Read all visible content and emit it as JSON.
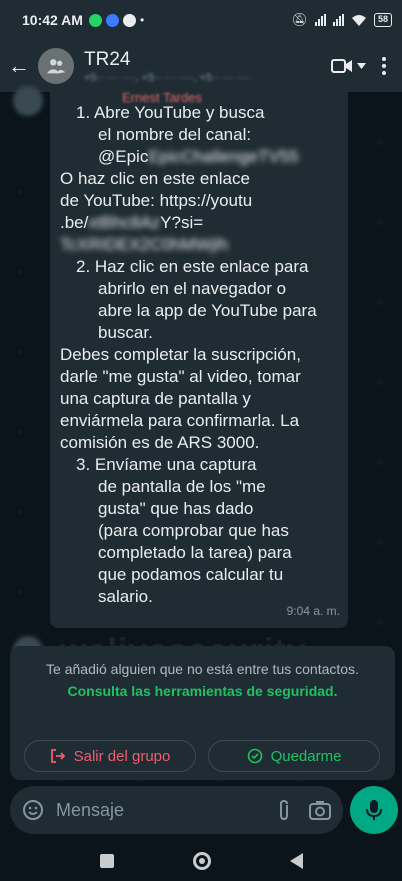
{
  "status_bar": {
    "time": "10:42 AM",
    "battery": "58"
  },
  "header": {
    "back_icon": "arrow-left-icon",
    "chat_title": "TR24",
    "chat_subtitle": "+5·· ··· ····, +5·· ··· ····, +5·· ··· ····",
    "video_icon": "video-call-icon",
    "menu_icon": "more-vert-icon"
  },
  "message": {
    "sender": "Ernest Tardes",
    "lines": {
      "l1": "1. Abre YouTube y busca",
      "l2": "el nombre del canal:",
      "l3": "@Epic",
      "l3_blur": "EpicChallengeTV55",
      "l4": "O haz clic en este enlace",
      "l5": "de YouTube: https://youtu",
      "l6a": ".be/",
      "l6_blur": "xtBhc8Az",
      "l6b": "Y?si=",
      "l7_blur": "TcXRIDEX2C0hMWjlh",
      "l8": "2. Haz clic en este enlace para",
      "l9": "abrirlo en el navegador o",
      "l10": "abre la app de YouTube para",
      "l11": "buscar.",
      "l12": "Debes completar la suscripción,",
      "l13": "darle \"me gusta\" al video, tomar",
      "l14": "una captura de pantalla y",
      "l15": "enviármela para confirmarla. La",
      "l16": "comisión es de ARS 3000.",
      "l17": "3. Envíame una captura",
      "l18": "de pantalla de los \"me",
      "l19": "gusta\" que has dado",
      "l20": "(para comprobar que has",
      "l21": "completado la tarea) para",
      "l22": "que podamos calcular tu",
      "l23": "salario."
    },
    "time": "9:04 a. m."
  },
  "watermark": "welivesecurity",
  "safety": {
    "text": "Te añadió alguien que no está entre tus contactos.",
    "link": "Consulta las herramientas de seguridad.",
    "exit_label": "Salir del grupo",
    "stay_label": "Quedarme"
  },
  "composer": {
    "placeholder": "Mensaje"
  },
  "colors": {
    "accent": "#00a884",
    "link_green": "#21c063",
    "danger": "#f15c6d"
  }
}
